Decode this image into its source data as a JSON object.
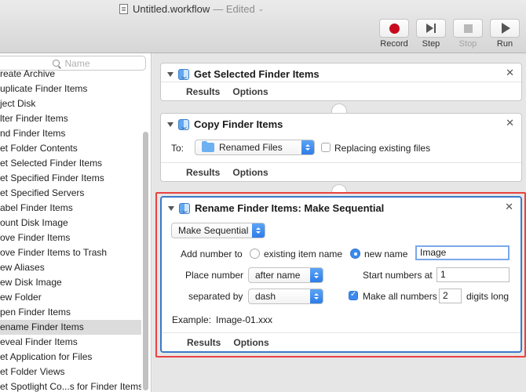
{
  "window": {
    "title": "Untitled.workflow",
    "edited": "— Edited"
  },
  "toolbar": {
    "record_label": "Record",
    "step_label": "Step",
    "stop_label": "Stop",
    "run_label": "Run"
  },
  "library": {
    "search_placeholder": "Name",
    "items": [
      "reate Archive",
      "uplicate Finder Items",
      "ject Disk",
      "lter Finder Items",
      "nd Finder Items",
      "et Folder Contents",
      "et Selected Finder Items",
      "et Specified Finder Items",
      "et Specified Servers",
      "abel Finder Items",
      "ount Disk Image",
      "ove Finder Items",
      "ove Finder Items to Trash",
      "ew Aliases",
      "ew Disk Image",
      "ew Folder",
      "pen Finder Items",
      "ename Finder Items",
      "eveal Finder Items",
      "et Application for Files",
      "et Folder Views",
      "et Spotlight Co...s for Finder Items"
    ],
    "selected_index": 17
  },
  "actions": {
    "get_selected": {
      "title": "Get Selected Finder Items",
      "tab_results": "Results",
      "tab_options": "Options"
    },
    "copy": {
      "title": "Copy Finder Items",
      "to_label": "To:",
      "to_value": "Renamed Files",
      "replacing_label": "Replacing existing files",
      "tab_results": "Results",
      "tab_options": "Options"
    },
    "rename": {
      "title": "Rename Finder Items: Make Sequential",
      "mode_value": "Make Sequential",
      "add_number_label": "Add number to",
      "radio_existing": "existing item name",
      "radio_new": "new name",
      "new_name_value": "Image",
      "place_number_label": "Place number",
      "place_number_value": "after name",
      "start_numbers_label": "Start numbers at",
      "start_numbers_value": "1",
      "separated_by_label": "separated by",
      "separated_by_value": "dash",
      "make_all_label": "Make all numbers",
      "digits_value": "2",
      "digits_long_label": "digits long",
      "example_label": "Example:",
      "example_value": "Image-01.xxx",
      "tab_results": "Results",
      "tab_options": "Options"
    }
  }
}
